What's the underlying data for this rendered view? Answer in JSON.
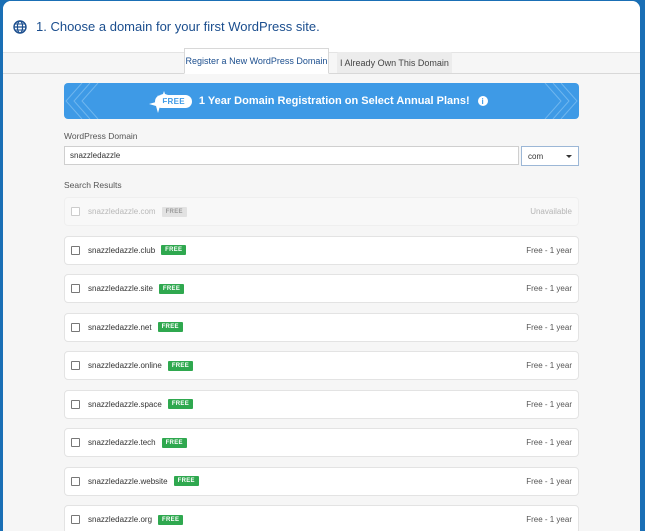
{
  "header": {
    "title": "1. Choose a domain for your first WordPress site.",
    "icon": "globe-icon"
  },
  "tabs": [
    {
      "label": "Register a New WordPress Domain",
      "active": true
    },
    {
      "label": "I Already Own This Domain",
      "active": false
    }
  ],
  "promo": {
    "badge": "FREE",
    "text": "1 Year Domain Registration on Select Annual Plans!",
    "info_icon": "i",
    "color": "#3e9ae6"
  },
  "form": {
    "domain_label": "WordPress Domain",
    "domain_value": "snazzledazzle",
    "tld_value": "com",
    "results_label": "Search Results"
  },
  "results": [
    {
      "domain": "snazzledazzle.com",
      "badge": "FREE",
      "price": "Unavailable",
      "available": false
    },
    {
      "domain": "snazzledazzle.club",
      "badge": "FREE",
      "price": "Free - 1 year",
      "available": true
    },
    {
      "domain": "snazzledazzle.site",
      "badge": "FREE",
      "price": "Free - 1 year",
      "available": true
    },
    {
      "domain": "snazzledazzle.net",
      "badge": "FREE",
      "price": "Free - 1 year",
      "available": true
    },
    {
      "domain": "snazzledazzle.online",
      "badge": "FREE",
      "price": "Free - 1 year",
      "available": true
    },
    {
      "domain": "snazzledazzle.space",
      "badge": "FREE",
      "price": "Free - 1 year",
      "available": true
    },
    {
      "domain": "snazzledazzle.tech",
      "badge": "FREE",
      "price": "Free - 1 year",
      "available": true
    },
    {
      "domain": "snazzledazzle.website",
      "badge": "FREE",
      "price": "Free - 1 year",
      "available": true
    },
    {
      "domain": "snazzledazzle.org",
      "badge": "FREE",
      "price": "Free - 1 year",
      "available": true
    }
  ],
  "colors": {
    "brand_blue": "#1a6fb5",
    "title_blue": "#1b4e8e",
    "free_green": "#2fa84f"
  }
}
